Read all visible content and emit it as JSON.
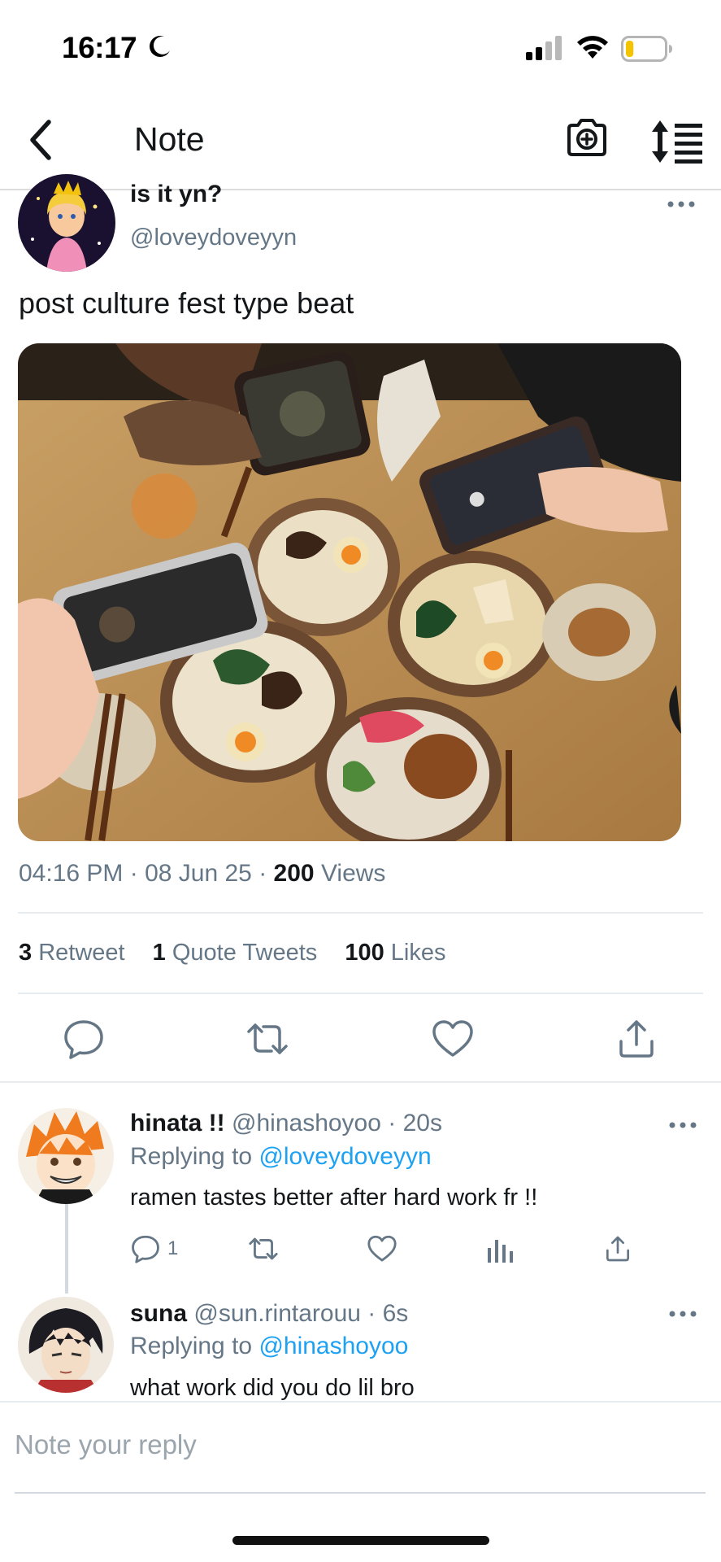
{
  "status_bar": {
    "time": "16:17",
    "battery_level": 0.2,
    "battery_color": "#f5c400"
  },
  "header": {
    "title": "Note",
    "back_icon": "chevron-left-icon",
    "camera_icon": "camera-plus-icon",
    "sort_icon": "sort-list-icon"
  },
  "main_tweet": {
    "name": "is it yn?",
    "handle": "@loveydoveyyn",
    "text": "post culture fest type beat",
    "time": "04:16 PM",
    "date": "08 Jun 25",
    "views_count": "200",
    "views_label": "Views",
    "stats": {
      "retweets_count": "3",
      "retweets_label": "Retweet",
      "quotes_count": "1",
      "quotes_label": "Quote Tweets",
      "likes_count": "100",
      "likes_label": "Likes"
    },
    "actions": [
      "reply-icon",
      "retweet-icon",
      "heart-icon",
      "share-icon"
    ]
  },
  "replies": [
    {
      "name": "hinata !!",
      "handle": "@hinashoyoo",
      "time": "20s",
      "replying_label": "Replying to",
      "replying_to": "@loveydoveyyn",
      "text": "ramen tastes better after hard work fr !!",
      "reply_count": "1"
    },
    {
      "name": "suna",
      "handle": "@sun.rintarouu",
      "time": "6s",
      "replying_label": "Replying to",
      "replying_to": "@hinashoyoo",
      "text": "what work did you do lil bro"
    }
  ],
  "reply_box": {
    "placeholder": "Note your reply"
  },
  "colors": {
    "accent": "#1da1f2",
    "secondary_text": "#657786",
    "primary_text": "#14171a",
    "divider": "#e6ecf0"
  }
}
